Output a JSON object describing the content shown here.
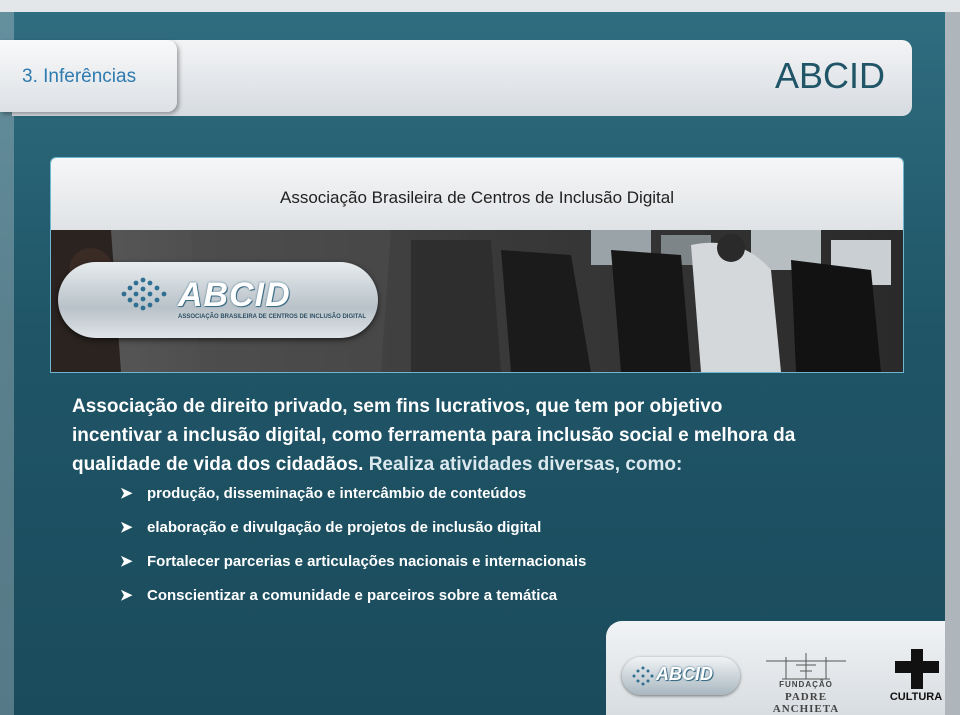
{
  "header": {
    "section_label": "3. Inferências",
    "title": "ABCID"
  },
  "photo": {
    "caption": "Associação Brasileira de Centros de Inclusão Digital",
    "badge_text": "ABCID",
    "badge_subtext": "ASSOCIAÇÃO BRASILEIRA DE CENTROS DE INCLUSÃO DIGITAL"
  },
  "body": {
    "intro_line1": "Associação de direito privado, sem fins lucrativos, que tem por objetivo",
    "intro_line2": "incentivar a inclusão digital, como ferramenta para inclusão social e melhora da",
    "intro_line3a": "qualidade de vida dos cidadãos.",
    "intro_line3b": " Realiza atividades diversas, como:",
    "bullets": [
      "produção, disseminação e intercâmbio de conteúdos",
      "elaboração e divulgação de projetos de inclusão digital",
      "Fortalecer parcerias e articulações nacionais e internacionais",
      "Conscientizar a comunidade e parceiros sobre a temática"
    ]
  },
  "footer": {
    "abcid_logo": "ABCID",
    "fpa_line1": "FUNDAÇÃO",
    "fpa_line2": "PADRE ANCHIETA",
    "cultura_logo": "CULTURA"
  },
  "colors": {
    "panel": "#1f5567",
    "accent": "#2e7bb0",
    "title": "#1f5567"
  },
  "icons": [
    "arrow-bullet-icon",
    "globe-icon",
    "cultura-cross-icon"
  ]
}
